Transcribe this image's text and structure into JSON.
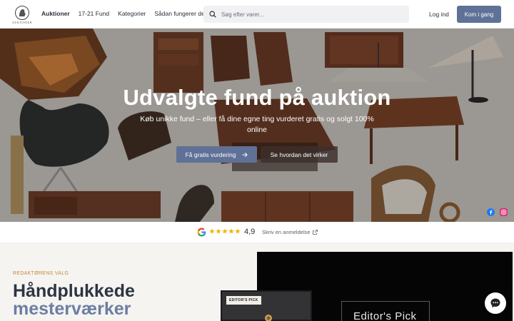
{
  "header": {
    "logo_text": "AUKTIONER",
    "nav": [
      "Auktioner",
      "17-21 Fund",
      "Kategorier",
      "Sådan fungerer det"
    ],
    "search_placeholder": "Søg efter varer...",
    "login": "Log ind",
    "cta": "Kom i gang"
  },
  "hero": {
    "title": "Udvalgte fund på auktion",
    "subtitle": "Køb unikke fund – eller få dine egne ting vurderet gratis og solgt 100% online",
    "primary_button": "Få gratis vurdering",
    "secondary_button": "Se hvordan det virker",
    "social_icons": [
      "facebook-icon",
      "instagram-icon"
    ]
  },
  "rating": {
    "stars": 5,
    "value": "4,9",
    "review_link": "Skriv en anmeldelse"
  },
  "editors": {
    "eyebrow": "REDAKTØRENS VALG",
    "heading_line1": "Håndplukkede",
    "heading_line2": "mesterværker",
    "card_tag": "EDITOR'S PICK",
    "panel_title": "Editor's Pick"
  },
  "colors": {
    "accent": "#5f7196",
    "eyebrow": "#c48a3a",
    "heading": "#2d3542",
    "heading_accent": "#6b7ea3",
    "star": "#f5b400"
  }
}
